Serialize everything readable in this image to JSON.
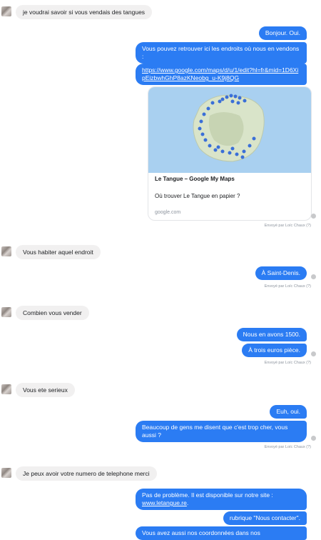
{
  "messages": {
    "m1": "je voudrai savoir si vous vendais des tangues",
    "m2": "Bonjour. Oui.",
    "m3": "Vous pouvez retrouver ici les endroits où nous en vendons :",
    "m4": "https://www.google.com/maps/d/u/1/edit?hl=fr&mid=1D6XipEizbwhGhP8azKNeobg_u-K9j8QG",
    "m5": "Vous habiter aquel endroit",
    "m6": "À Saint-Denis.",
    "m7": "Combien vous vender",
    "m8": "Nous en avons 1500.",
    "m9": "À trois euros pièce.",
    "m10": "Vous ete serieux",
    "m11": "Euh, oui.",
    "m12": "Beaucoup de gens me disent que c'est trop cher, vous aussi ?",
    "m13": "Je peux  avoir votre numero de telephone merci",
    "m14_text": "Pas de problème. Il est disponible sur notre site :",
    "m14_link": "www.letangue.re",
    "m14_end": ".",
    "m15": "rubrique \"Nous contacter\".",
    "m16": "Vous avez aussi nos coordonnées dans nos"
  },
  "link_preview": {
    "title": "Le Tangue – Google My Maps",
    "description": "Où trouver Le Tangue en papier ?",
    "domain": "google.com"
  },
  "sent_by": "Envoyé par Loïc Chaux (?)",
  "colors": {
    "outgoing": "#2b7cf3",
    "incoming": "#f1f0f0",
    "map_sea": "#a9d0f0",
    "map_land": "#d9e4c9",
    "pin": "#3a6fd8"
  }
}
